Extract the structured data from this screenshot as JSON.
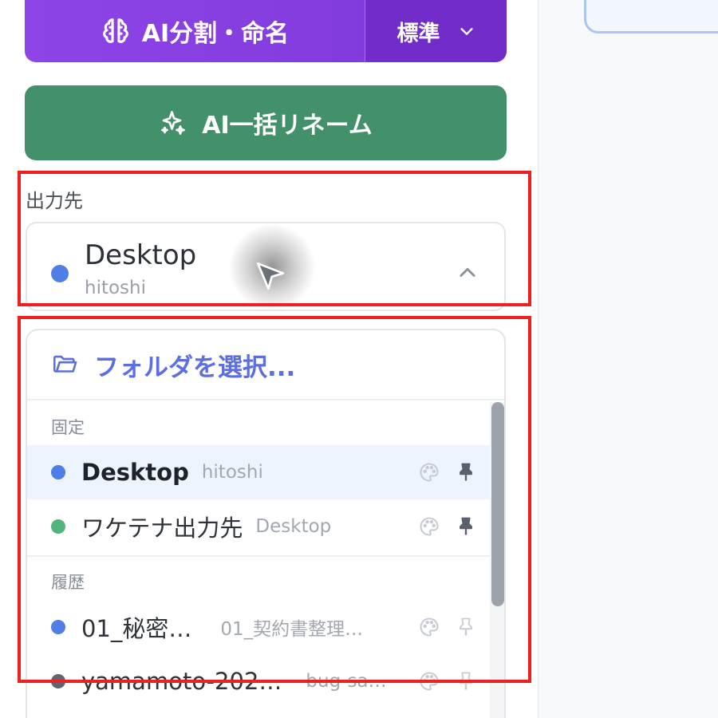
{
  "split_button": {
    "label": "AI分割・命名",
    "mode": "標準",
    "icon": "brain-icon",
    "chevron": "chevron-down-icon"
  },
  "rename_button": {
    "label": "AI一括リネーム",
    "icon": "sparkles-icon"
  },
  "output": {
    "label": "出力先",
    "selected": {
      "name": "Desktop",
      "sub": "hitoshi",
      "color": "#4f7fe6"
    }
  },
  "dropdown": {
    "choose_folder": "フォルダを選択...",
    "pinned_header": "固定",
    "pinned": [
      {
        "name": "Desktop",
        "sub": "hitoshi",
        "color": "#4f7fe6"
      },
      {
        "name": "ワケテナ出力先",
        "sub": "Desktop",
        "color": "#52b57d"
      }
    ],
    "history_header": "履歴",
    "history": [
      {
        "name": "01_秘密…",
        "sub": "01_契約書整理…",
        "color": "#4f7fe6"
      },
      {
        "name": "yamamoto-202…",
        "sub": "bug-sa…",
        "color": "#5f6470"
      }
    ]
  },
  "colors": {
    "accent_purple": "#8e45e8",
    "accent_green": "#42916a",
    "highlight_red": "#ef2020"
  }
}
